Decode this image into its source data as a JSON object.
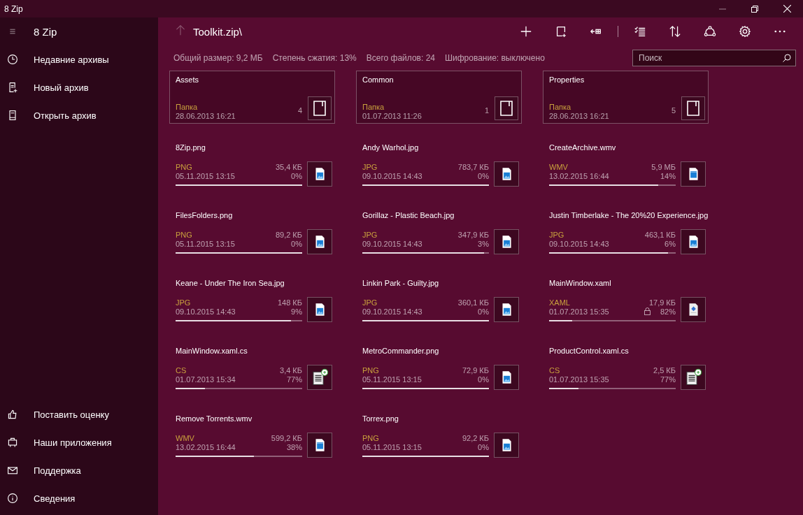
{
  "window": {
    "title": "8 Zip"
  },
  "sidebar": {
    "title": "8 Zip",
    "top_items": [
      {
        "label": "Недавние архивы"
      },
      {
        "label": "Новый архив"
      },
      {
        "label": "Открыть архив"
      }
    ],
    "bottom_items": [
      {
        "label": "Поставить оценку"
      },
      {
        "label": "Наши приложения"
      },
      {
        "label": "Поддержка"
      },
      {
        "label": "Сведения"
      }
    ]
  },
  "path": "Toolkit.zip\\",
  "stats": [
    "Общий размер: 9,2 МБ",
    "Степень сжатия: 13%",
    "Всего файлов: 24",
    "Шифрование: выключено"
  ],
  "search": {
    "placeholder": "Поиск"
  },
  "folders": [
    {
      "name": "Assets",
      "type": "Папка",
      "date": "28.06.2013 16:21",
      "count": "4"
    },
    {
      "name": "Common",
      "type": "Папка",
      "date": "01.07.2013 11:26",
      "count": "1"
    },
    {
      "name": "Properties",
      "type": "Папка",
      "date": "28.06.2013 16:21",
      "count": "5"
    }
  ],
  "files": [
    {
      "name": "8Zip.png",
      "type": "PNG",
      "size": "35,4 КБ",
      "date": "05.11.2015 13:15",
      "ratio": "0%",
      "level": 1,
      "locked": false,
      "kind": "image"
    },
    {
      "name": "Andy Warhol.jpg",
      "type": "JPG",
      "size": "783,7 КБ",
      "date": "09.10.2015 14:43",
      "ratio": "0%",
      "level": 1,
      "locked": false,
      "kind": "image"
    },
    {
      "name": "CreateArchive.wmv",
      "type": "WMV",
      "size": "5,9 МБ",
      "date": "13.02.2015 16:44",
      "ratio": "14%",
      "level": 0.86,
      "locked": false,
      "kind": "video"
    },
    {
      "name": "FilesFolders.png",
      "type": "PNG",
      "size": "89,2 КБ",
      "date": "05.11.2015 13:15",
      "ratio": "0%",
      "level": 1,
      "locked": false,
      "kind": "image"
    },
    {
      "name": "Gorillaz - Plastic Beach.jpg",
      "type": "JPG",
      "size": "347,9 КБ",
      "date": "09.10.2015 14:43",
      "ratio": "3%",
      "level": 0.96,
      "locked": false,
      "kind": "image"
    },
    {
      "name": "Justin Timberlake - The 20%20 Experience.jpg",
      "type": "JPG",
      "size": "463,1 КБ",
      "date": "09.10.2015 14:43",
      "ratio": "6%",
      "level": 0.94,
      "locked": false,
      "kind": "image"
    },
    {
      "name": "Keane - Under The Iron Sea.jpg",
      "type": "JPG",
      "size": "148 КБ",
      "date": "09.10.2015 14:43",
      "ratio": "9%",
      "level": 0.91,
      "locked": false,
      "kind": "image"
    },
    {
      "name": "Linkin Park - Guilty.jpg",
      "type": "JPG",
      "size": "360,1 КБ",
      "date": "09.10.2015 14:43",
      "ratio": "0%",
      "level": 1,
      "locked": false,
      "kind": "image"
    },
    {
      "name": "MainWindow.xaml",
      "type": "XAML",
      "size": "17,9 КБ",
      "date": "01.07.2013 15:35",
      "ratio": "82%",
      "level": 0.18,
      "locked": true,
      "kind": "xaml"
    },
    {
      "name": "MainWindow.xaml.cs",
      "type": "CS",
      "size": "3,4 КБ",
      "date": "01.07.2013 15:34",
      "ratio": "77%",
      "level": 0.23,
      "locked": false,
      "kind": "cs"
    },
    {
      "name": "MetroCommander.png",
      "type": "PNG",
      "size": "72,9 КБ",
      "date": "05.11.2015 13:15",
      "ratio": "0%",
      "level": 1,
      "locked": false,
      "kind": "image"
    },
    {
      "name": "ProductControl.xaml.cs",
      "type": "CS",
      "size": "2,5 КБ",
      "date": "01.07.2013 15:35",
      "ratio": "77%",
      "level": 0.23,
      "locked": false,
      "kind": "cs"
    },
    {
      "name": "Remove Torrents.wmv",
      "type": "WMV",
      "size": "599,2 КБ",
      "date": "13.02.2015 16:44",
      "ratio": "38%",
      "level": 0.62,
      "locked": false,
      "kind": "video"
    },
    {
      "name": "Torrex.png",
      "type": "PNG",
      "size": "92,2 КБ",
      "date": "05.11.2015 13:15",
      "ratio": "0%",
      "level": 1,
      "locked": false,
      "kind": "image"
    }
  ]
}
